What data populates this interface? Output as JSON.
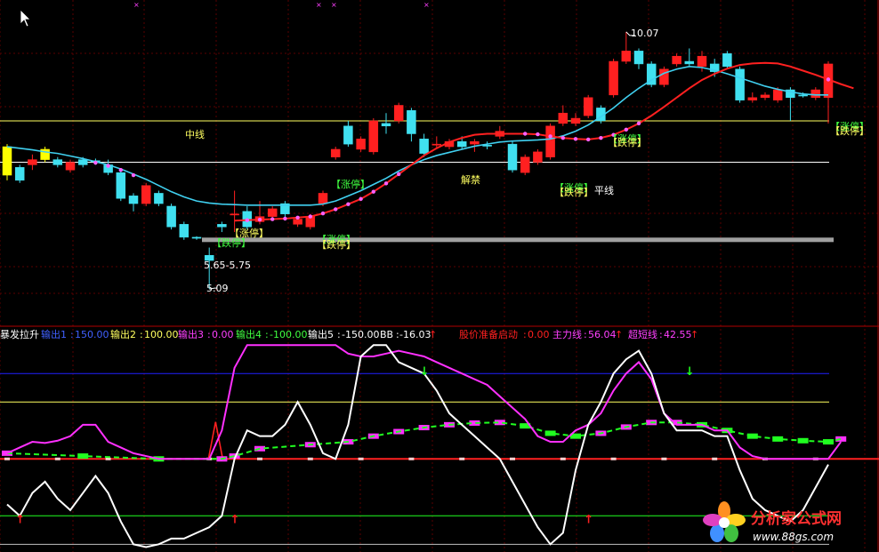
{
  "colors": {
    "background": "#000000",
    "grid": "#5a0000",
    "panel_border": "#b00000",
    "up_candle": "#ff2020",
    "down_candle": "#40e0f0",
    "ma_cyan": "#40d0f0",
    "ma_red": "#ff2020",
    "ma_dots": "#ff60ff",
    "limit_tag": "#40ff40",
    "yellow": "#ffff60",
    "white": "#ffffff",
    "magenta": "#ff30ff",
    "green": "#20ff20",
    "blue": "#2020ff",
    "gray_bar": "#a0a0a0"
  },
  "watermark": {
    "name": "分析家公式网",
    "url": "www.88gs.com"
  },
  "chart_data": [
    {
      "type": "candlestick",
      "panel": "price",
      "annotations": {
        "high_price": "10.07",
        "low_price": "5.09",
        "range_label": "5.65-5.75",
        "mid_line": "中线",
        "flat_line": "平线",
        "unlock": "解禁",
        "limit_up": "【涨停】",
        "limit_down": "【跌停】",
        "limit_up_x": "【涨停】",
        "limit_down_x": "【跌停】"
      },
      "ylim": [
        4.5,
        10.6
      ],
      "reference_levels": {
        "mid_line": 8.35,
        "flat_line": 7.55,
        "base_bar": 6.05
      },
      "candles": [
        {
          "o": 7.3,
          "c": 7.85,
          "h": 7.9,
          "l": 7.2
        },
        {
          "o": 7.45,
          "c": 7.2,
          "h": 7.5,
          "l": 7.15
        },
        {
          "o": 7.5,
          "c": 7.6,
          "h": 7.7,
          "l": 7.4
        },
        {
          "o": 7.6,
          "c": 7.8,
          "h": 7.85,
          "l": 7.55
        },
        {
          "o": 7.6,
          "c": 7.5,
          "h": 7.65,
          "l": 7.45
        },
        {
          "o": 7.4,
          "c": 7.55,
          "h": 7.6,
          "l": 7.35
        },
        {
          "o": 7.6,
          "c": 7.5,
          "h": 7.65,
          "l": 7.45
        },
        {
          "o": 7.58,
          "c": 7.56,
          "h": 7.62,
          "l": 7.5
        },
        {
          "o": 7.5,
          "c": 7.35,
          "h": 7.6,
          "l": 7.3
        },
        {
          "o": 7.35,
          "c": 6.85,
          "h": 7.4,
          "l": 6.8
        },
        {
          "o": 6.9,
          "c": 6.75,
          "h": 6.95,
          "l": 6.6
        },
        {
          "o": 6.75,
          "c": 7.1,
          "h": 7.15,
          "l": 6.7
        },
        {
          "o": 6.95,
          "c": 6.75,
          "h": 7.0,
          "l": 6.7
        },
        {
          "o": 6.7,
          "c": 6.3,
          "h": 6.75,
          "l": 6.25
        },
        {
          "o": 6.35,
          "c": 6.1,
          "h": 6.4,
          "l": 6.05
        },
        {
          "o": 6.1,
          "c": 6.08,
          "h": 6.12,
          "l": 6.05
        },
        {
          "o": 5.75,
          "c": 5.65,
          "h": 5.9,
          "l": 5.1
        },
        {
          "o": 6.35,
          "c": 6.3,
          "h": 6.4,
          "l": 6.2
        },
        {
          "o": 6.55,
          "c": 6.55,
          "h": 7.0,
          "l": 6.2
        },
        {
          "o": 6.6,
          "c": 6.3,
          "h": 6.7,
          "l": 6.25
        },
        {
          "o": 6.4,
          "c": 6.5,
          "h": 6.8,
          "l": 6.35
        },
        {
          "o": 6.5,
          "c": 6.65,
          "h": 6.7,
          "l": 6.45
        },
        {
          "o": 6.75,
          "c": 6.55,
          "h": 6.8,
          "l": 6.45
        },
        {
          "o": 6.35,
          "c": 6.45,
          "h": 6.5,
          "l": 6.3
        },
        {
          "o": 6.3,
          "c": 6.5,
          "h": 6.55,
          "l": 6.25
        },
        {
          "o": 6.75,
          "c": 6.95,
          "h": 7.0,
          "l": 6.7
        },
        {
          "o": 7.65,
          "c": 7.8,
          "h": 7.85,
          "l": 7.6
        },
        {
          "o": 8.25,
          "c": 7.9,
          "h": 8.35,
          "l": 7.85
        },
        {
          "o": 7.8,
          "c": 8.0,
          "h": 8.05,
          "l": 7.75
        },
        {
          "o": 7.75,
          "c": 8.35,
          "h": 8.4,
          "l": 7.7
        },
        {
          "o": 8.3,
          "c": 8.25,
          "h": 8.5,
          "l": 8.1
        },
        {
          "o": 8.35,
          "c": 8.65,
          "h": 8.7,
          "l": 8.3
        },
        {
          "o": 8.55,
          "c": 8.1,
          "h": 8.6,
          "l": 7.95
        },
        {
          "o": 8.0,
          "c": 7.72,
          "h": 8.1,
          "l": 7.65
        },
        {
          "o": 7.88,
          "c": 7.9,
          "h": 8.05,
          "l": 7.8
        },
        {
          "o": 7.85,
          "c": 7.95,
          "h": 8.0,
          "l": 7.8
        },
        {
          "o": 7.95,
          "c": 7.85,
          "h": 8.05,
          "l": 7.8
        },
        {
          "o": 7.9,
          "c": 7.95,
          "h": 8.0,
          "l": 7.75
        },
        {
          "o": 7.88,
          "c": 7.86,
          "h": 7.95,
          "l": 7.8
        },
        {
          "o": 8.05,
          "c": 8.15,
          "h": 8.25,
          "l": 8.0
        },
        {
          "o": 7.9,
          "c": 7.4,
          "h": 7.95,
          "l": 7.35
        },
        {
          "o": 7.35,
          "c": 7.65,
          "h": 7.7,
          "l": 7.3
        },
        {
          "o": 7.55,
          "c": 7.75,
          "h": 7.8,
          "l": 7.5
        },
        {
          "o": 7.65,
          "c": 8.25,
          "h": 8.3,
          "l": 7.6
        },
        {
          "o": 8.3,
          "c": 8.5,
          "h": 8.65,
          "l": 8.25
        },
        {
          "o": 8.3,
          "c": 8.4,
          "h": 8.5,
          "l": 8.25
        },
        {
          "o": 8.45,
          "c": 8.8,
          "h": 8.85,
          "l": 8.4
        },
        {
          "o": 8.6,
          "c": 8.35,
          "h": 8.65,
          "l": 8.3
        },
        {
          "o": 8.85,
          "c": 9.5,
          "h": 9.55,
          "l": 8.8
        },
        {
          "o": 9.5,
          "c": 9.7,
          "h": 10.07,
          "l": 9.45
        },
        {
          "o": 9.7,
          "c": 9.45,
          "h": 9.75,
          "l": 9.35
        },
        {
          "o": 9.45,
          "c": 9.05,
          "h": 9.5,
          "l": 9.0
        },
        {
          "o": 9.05,
          "c": 9.35,
          "h": 9.4,
          "l": 9.0
        },
        {
          "o": 9.45,
          "c": 9.6,
          "h": 9.65,
          "l": 9.4
        },
        {
          "o": 9.5,
          "c": 9.45,
          "h": 9.75,
          "l": 9.4
        },
        {
          "o": 9.4,
          "c": 9.6,
          "h": 9.7,
          "l": 9.3
        },
        {
          "o": 9.45,
          "c": 9.3,
          "h": 9.55,
          "l": 9.2
        },
        {
          "o": 9.65,
          "c": 9.4,
          "h": 9.7,
          "l": 9.35
        },
        {
          "o": 9.35,
          "c": 8.75,
          "h": 9.4,
          "l": 8.7
        },
        {
          "o": 8.75,
          "c": 8.8,
          "h": 8.9,
          "l": 8.7
        },
        {
          "o": 8.8,
          "c": 8.85,
          "h": 8.9,
          "l": 8.75
        },
        {
          "o": 8.75,
          "c": 8.95,
          "h": 9.0,
          "l": 8.7
        },
        {
          "o": 8.95,
          "c": 8.8,
          "h": 9.0,
          "l": 8.35
        },
        {
          "o": 8.85,
          "c": 8.83,
          "h": 8.9,
          "l": 8.8
        },
        {
          "o": 8.8,
          "c": 8.95,
          "h": 9.0,
          "l": 8.75
        },
        {
          "o": 8.8,
          "c": 9.45,
          "h": 9.5,
          "l": 8.3
        }
      ],
      "ma_cyan": [
        7.85,
        7.82,
        7.79,
        7.75,
        7.72,
        7.67,
        7.62,
        7.56,
        7.5,
        7.42,
        7.32,
        7.22,
        7.1,
        6.98,
        6.88,
        6.8,
        6.76,
        6.74,
        6.73,
        6.72,
        6.72,
        6.72,
        6.72,
        6.72,
        6.72,
        6.74,
        6.8,
        6.9,
        7.0,
        7.12,
        7.24,
        7.38,
        7.5,
        7.6,
        7.68,
        7.74,
        7.8,
        7.86,
        7.9,
        7.94,
        7.96,
        7.97,
        7.98,
        8.0,
        8.06,
        8.15,
        8.27,
        8.43,
        8.6,
        8.8,
        8.98,
        9.14,
        9.27,
        9.35,
        9.4,
        9.38,
        9.33,
        9.26,
        9.18,
        9.1,
        9.02,
        8.96,
        8.91,
        8.87,
        8.85,
        8.85
      ],
      "ma_red_start": 18,
      "ma_red": [
        6.42,
        6.43,
        6.44,
        6.45,
        6.46,
        6.48,
        6.5,
        6.56,
        6.64,
        6.74,
        6.84,
        6.98,
        7.14,
        7.32,
        7.5,
        7.68,
        7.82,
        7.94,
        8.02,
        8.08,
        8.1,
        8.1,
        8.1,
        8.1,
        8.09,
        8.05,
        8.02,
        8.0,
        7.99,
        8.02,
        8.08,
        8.18,
        8.3,
        8.45,
        8.62,
        8.8,
        8.98,
        9.14,
        9.26,
        9.36,
        9.43,
        9.46,
        9.47,
        9.46,
        9.4,
        9.32,
        9.24,
        9.15,
        9.06,
        8.98
      ]
    },
    {
      "type": "line",
      "panel": "indicator",
      "indicator_name": "暴发拉升",
      "legend": [
        {
          "name": "输出1",
          "value": "150.00"
        },
        {
          "name": "输出2",
          "value": "100.00"
        },
        {
          "name": "输出3",
          "value": "0.00"
        },
        {
          "name": "输出4",
          "value": "-100.00"
        },
        {
          "name": "输出5",
          "value": "-150.00"
        },
        {
          "name": "BB",
          "value": "-16.03"
        },
        {
          "name": "股价准备启动",
          "value": "0.00"
        },
        {
          "name": "主力线",
          "value": "56.04"
        },
        {
          "name": "超短线",
          "value": "42.55"
        }
      ],
      "ylim": [
        -162,
        205
      ],
      "levels": [
        150,
        100,
        0,
        -100,
        -150
      ],
      "white_line": [
        -80,
        -100,
        -60,
        -40,
        -70,
        -90,
        -60,
        -30,
        -60,
        -110,
        -150,
        -155,
        -150,
        -140,
        -140,
        -130,
        -120,
        -100,
        0,
        50,
        40,
        40,
        60,
        100,
        60,
        10,
        0,
        60,
        180,
        200,
        200,
        170,
        160,
        150,
        120,
        80,
        60,
        40,
        20,
        0,
        -40,
        -80,
        -120,
        -150,
        -130,
        -20,
        60,
        100,
        150,
        175,
        190,
        150,
        80,
        50,
        50,
        50,
        40,
        40,
        -20,
        -70,
        -90,
        -100,
        -110,
        -90,
        -50,
        -10
      ],
      "magenta_line": [
        10,
        20,
        30,
        28,
        32,
        40,
        60,
        60,
        30,
        20,
        10,
        5,
        0,
        0,
        0,
        0,
        0,
        50,
        160,
        200,
        200,
        200,
        200,
        200,
        200,
        200,
        200,
        185,
        180,
        180,
        185,
        190,
        185,
        180,
        170,
        160,
        150,
        140,
        130,
        110,
        90,
        70,
        40,
        30,
        30,
        50,
        60,
        80,
        120,
        150,
        170,
        140,
        80,
        60,
        60,
        60,
        50,
        50,
        20,
        5,
        0,
        0,
        0,
        0,
        0,
        0,
        30
      ],
      "bb_points": [
        {
          "x": 0,
          "y": 10
        },
        {
          "x": 6,
          "y": 5
        },
        {
          "x": 12,
          "y": 0
        },
        {
          "x": 17,
          "y": 0
        },
        {
          "x": 18,
          "y": 5
        },
        {
          "x": 20,
          "y": 18
        },
        {
          "x": 24,
          "y": 25
        },
        {
          "x": 27,
          "y": 30
        },
        {
          "x": 29,
          "y": 40
        },
        {
          "x": 31,
          "y": 48
        },
        {
          "x": 33,
          "y": 55
        },
        {
          "x": 35,
          "y": 60
        },
        {
          "x": 37,
          "y": 63
        },
        {
          "x": 39,
          "y": 64
        },
        {
          "x": 41,
          "y": 58
        },
        {
          "x": 43,
          "y": 45
        },
        {
          "x": 45,
          "y": 40
        },
        {
          "x": 47,
          "y": 45
        },
        {
          "x": 49,
          "y": 56
        },
        {
          "x": 51,
          "y": 64
        },
        {
          "x": 53,
          "y": 64
        },
        {
          "x": 55,
          "y": 60
        },
        {
          "x": 57,
          "y": 50
        },
        {
          "x": 59,
          "y": 40
        },
        {
          "x": 61,
          "y": 35
        },
        {
          "x": 63,
          "y": 32
        },
        {
          "x": 65,
          "y": 30
        },
        {
          "x": 66,
          "y": 35
        }
      ],
      "spike": {
        "x": 16.5,
        "peak": 65
      },
      "up_arrows": [
        1,
        18,
        46
      ],
      "down_arrows": [
        33,
        54
      ]
    }
  ]
}
